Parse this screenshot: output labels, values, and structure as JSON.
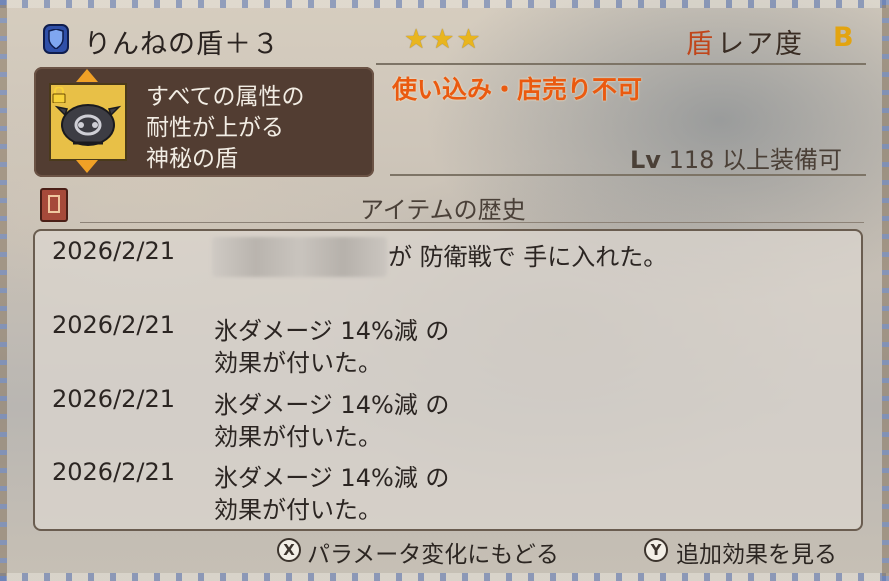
{
  "header": {
    "item_name": "りんねの盾＋３",
    "stars": "★★★",
    "category": "盾",
    "rarity_label": "レア度",
    "rarity_value": "B"
  },
  "item_panel": {
    "description_lines": [
      "すべての属性の",
      "耐性が上がる",
      "神秘の盾"
    ]
  },
  "restriction_text": "使い込み・店売り不可",
  "level": {
    "prefix": "Lv",
    "value": "118",
    "suffix": "以上装備可"
  },
  "history": {
    "title": "アイテムの歴史",
    "entries": [
      {
        "date": "2026/2/21",
        "lines": [
          "が 防衛戦で 手に入れた。"
        ]
      },
      {
        "date": "2026/2/21",
        "lines": [
          "氷ダメージ 14%減 の",
          "効果が付いた。"
        ]
      },
      {
        "date": "2026/2/21",
        "lines": [
          "氷ダメージ 14%減 の",
          "効果が付いた。"
        ]
      },
      {
        "date": "2026/2/21",
        "lines": [
          "氷ダメージ 14%減 の",
          "効果が付いた。"
        ]
      }
    ]
  },
  "footer": {
    "x_button": "X",
    "x_label": "パラメータ変化にもどる",
    "y_button": "Y",
    "y_label": "追加効果を見る"
  },
  "colors": {
    "accent_orange": "#ea5a10",
    "star_gold": "#e9b51e",
    "panel_brown": "#523d32"
  }
}
